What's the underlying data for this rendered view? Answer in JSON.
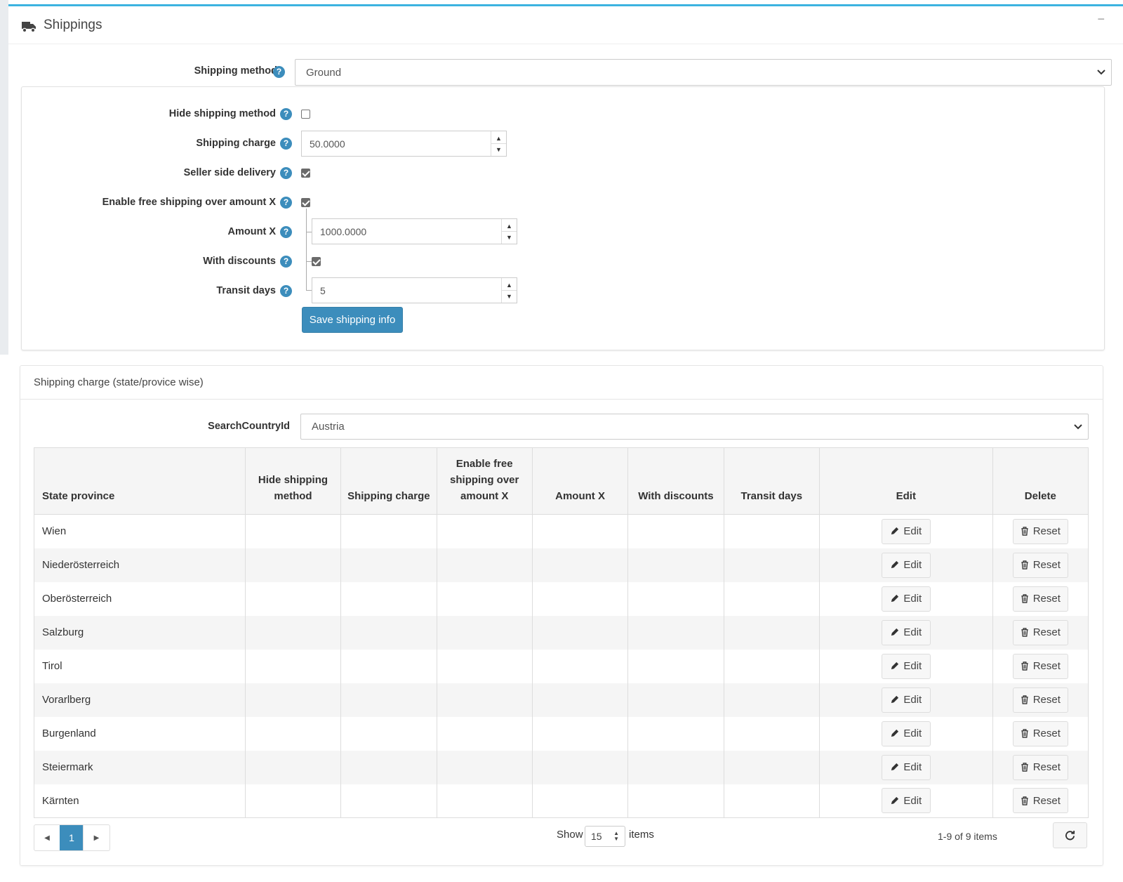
{
  "panel": {
    "title": "Shippings",
    "collapse_icon": "minus-icon"
  },
  "shipping_method": {
    "label": "Shipping method",
    "value": "Ground"
  },
  "settings": {
    "hide_shipping_method": {
      "label": "Hide shipping method",
      "checked": false
    },
    "shipping_charge": {
      "label": "Shipping charge",
      "value": "50.0000"
    },
    "seller_side_delivery": {
      "label": "Seller side delivery",
      "checked": true
    },
    "enable_free_shipping": {
      "label": "Enable free shipping over amount X",
      "checked": true
    },
    "amount_x": {
      "label": "Amount X",
      "value": "1000.0000"
    },
    "with_discounts": {
      "label": "With discounts",
      "checked": true
    },
    "transit_days": {
      "label": "Transit days",
      "value": "5"
    },
    "save_label": "Save shipping info"
  },
  "state_panel": {
    "title": "Shipping charge (state/provice wise)",
    "search_country": {
      "label": "SearchCountryId",
      "value": "Austria"
    },
    "columns": {
      "state": "State province",
      "hide": "Hide shipping method",
      "charge": "Shipping charge",
      "free": "Enable free shipping over amount X",
      "amount": "Amount X",
      "discounts": "With discounts",
      "transit": "Transit days",
      "edit": "Edit",
      "delete": "Delete"
    },
    "edit_label": "Edit",
    "reset_label": "Reset",
    "rows": [
      {
        "state": "Wien"
      },
      {
        "state": "Niederösterreich"
      },
      {
        "state": "Oberösterreich"
      },
      {
        "state": "Salzburg"
      },
      {
        "state": "Tirol"
      },
      {
        "state": "Vorarlberg"
      },
      {
        "state": "Burgenland"
      },
      {
        "state": "Steiermark"
      },
      {
        "state": "Kärnten"
      }
    ]
  },
  "pagination": {
    "current_page": "1",
    "show_label": "Show",
    "page_size": "15",
    "items_label": "items",
    "range": "1-9 of 9 items"
  },
  "colors": {
    "primary": "#3c8dbc",
    "accent_border": "#3cb3e0"
  }
}
